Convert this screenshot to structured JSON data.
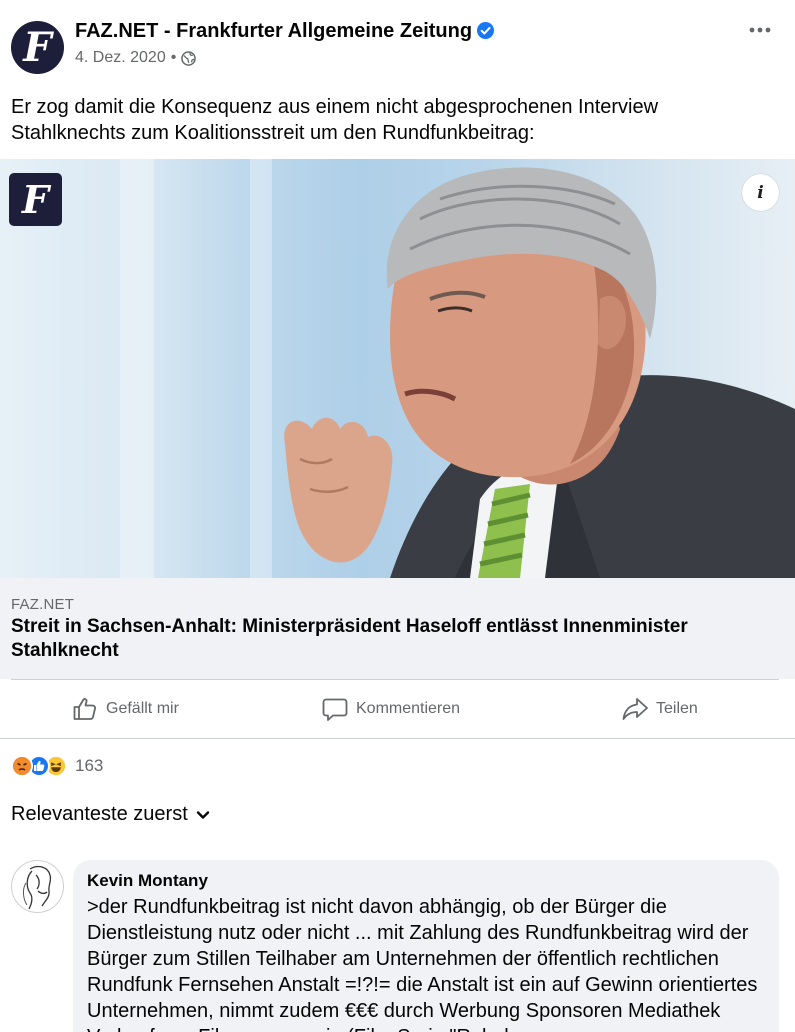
{
  "post": {
    "page_name": "FAZ.NET - Frankfurter Allgemeine Zeitung",
    "avatar_letter": "F",
    "date": "4. Dez. 2020",
    "separator": "•",
    "more_icon": "more-horizontal-icon",
    "verified_icon": "verified-badge-icon",
    "privacy_icon": "globe-icon",
    "text": "Er zog damit die Konsequenz aus einem nicht abgesprochenen Interview Stahlknechts zum Koalitionsstreit um den Rundfunkbeitrag:"
  },
  "link": {
    "logo_letter": "F",
    "info_label": "i",
    "domain": "FAZ.NET",
    "title": "Streit in Sachsen-Anhalt: Ministerpräsident Haseloff entlässt Innenminister Stahlknecht"
  },
  "actions": {
    "like": "Gefällt mir",
    "comment": "Kommentieren",
    "share": "Teilen"
  },
  "reactions": {
    "types": [
      "angry",
      "like",
      "haha"
    ],
    "count": "163"
  },
  "sort": {
    "label": "Relevanteste zuerst"
  },
  "comment": {
    "author": "Kevin Montany",
    "text": ">der Rundfunkbeitrag ist nicht davon abhängig, ob der Bürger die Dienstleistung nutz oder nicht ... mit Zahlung des Rundfunkbeitrag wird der Bürger zum Stillen Teilhaber am Unternehmen der öffentlich rechtlichen Rundfunk Fernsehen Anstalt =!?!= die Anstalt ist ein auf Gewinn orientiertes Unternehmen, nimmt zudem €€€ durch Werbung Sponsoren Mediathek Verkauf von Filmen, usw. ein (Film Serie \"Rebels"
  },
  "colors": {
    "brand_blue": "#1877f2",
    "faz_navy": "#1c1e3a",
    "secondary_text": "#65676b",
    "preview_bg": "#f0f2f5"
  }
}
